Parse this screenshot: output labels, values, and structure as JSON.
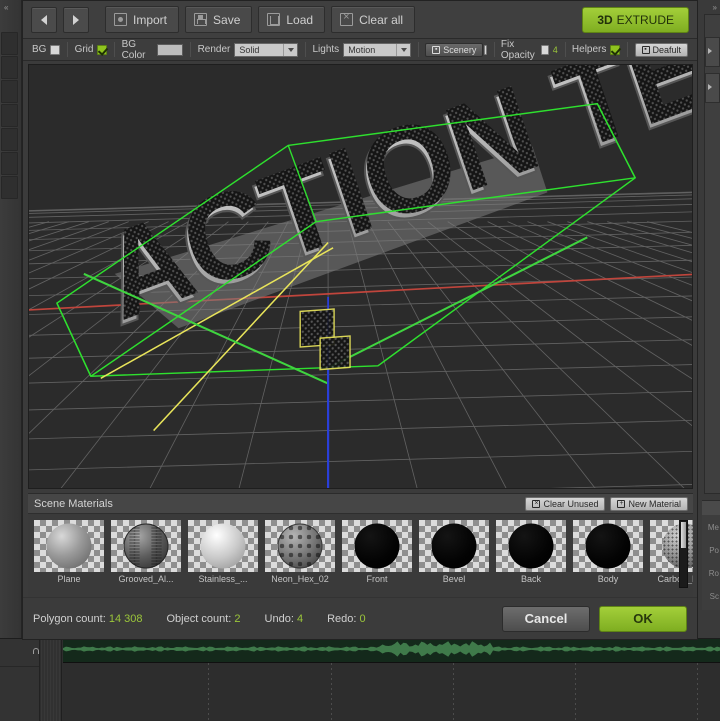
{
  "dialog": {
    "toolbar": {
      "nav_prev": "◀",
      "nav_next": "▶",
      "import_label": "Import",
      "save_label": "Save",
      "load_label": "Load",
      "clear_all_label": "Clear all",
      "extrude_prefix": "3D",
      "extrude_label": "EXTRUDE"
    },
    "options": {
      "bg_label": "BG",
      "bg_checked": false,
      "grid_label": "Grid",
      "grid_checked": true,
      "bg_color_label": "BG Color",
      "bg_color_value": "#bdbdbd",
      "render_label": "Render",
      "render_value": "Solid",
      "lights_label": "Lights",
      "lights_value": "Motion",
      "scenery_label": "Scenery",
      "scenery_checked": false,
      "fix_opacity_label": "Fix Opacity",
      "fix_opacity_checked": false,
      "fix_opacity_value": "4",
      "helpers_label": "Helpers",
      "helpers_checked": true,
      "default_label": "Deafult"
    },
    "viewport": {
      "object_text": "ACTION TECH",
      "selection_color": "#2ee02e",
      "axis_x_color": "#c8453c",
      "axis_y_color": "#2ee02e",
      "axis_z_color": "#2a3fd8",
      "gizmo_color": "#e8e45a",
      "grid_color": "#6e6e6e",
      "background_color": "#2b2b2b"
    },
    "materials": {
      "title": "Scene Materials",
      "clear_unused_label": "Clear Unused",
      "new_material_label": "New Material",
      "items": [
        {
          "label": "Plane",
          "swatch": "#9a9a9a",
          "kind": "matte"
        },
        {
          "label": "Grooved_Al...",
          "swatch": "#4a4a4a",
          "kind": "grooved"
        },
        {
          "label": "Stainless_...",
          "swatch": "#c9c9c9",
          "kind": "speckle"
        },
        {
          "label": "Neon_Hex_02",
          "swatch": "#8a8a8a",
          "kind": "hex"
        },
        {
          "label": "Front",
          "swatch": "#030303",
          "kind": "flat"
        },
        {
          "label": "Bevel",
          "swatch": "#030303",
          "kind": "flat"
        },
        {
          "label": "Back",
          "swatch": "#030303",
          "kind": "flat"
        },
        {
          "label": "Body",
          "swatch": "#030303",
          "kind": "flat"
        },
        {
          "label": "Carbon_Fiber",
          "swatch": "#8e8e8e",
          "kind": "carbon"
        }
      ]
    },
    "status": {
      "polygon_label": "Polygon count:",
      "polygon_value": "14 308",
      "object_label": "Object count:",
      "object_value": "2",
      "undo_label": "Undo:",
      "undo_value": "4",
      "redo_label": "Redo:",
      "redo_value": "0",
      "cancel_label": "Cancel",
      "ok_label": "OK"
    }
  },
  "background_app": {
    "left_collapse_icon": "«",
    "right_collapse_icon": "»",
    "property_labels": [
      "Me",
      "Po",
      "Ro",
      "Sc"
    ]
  }
}
